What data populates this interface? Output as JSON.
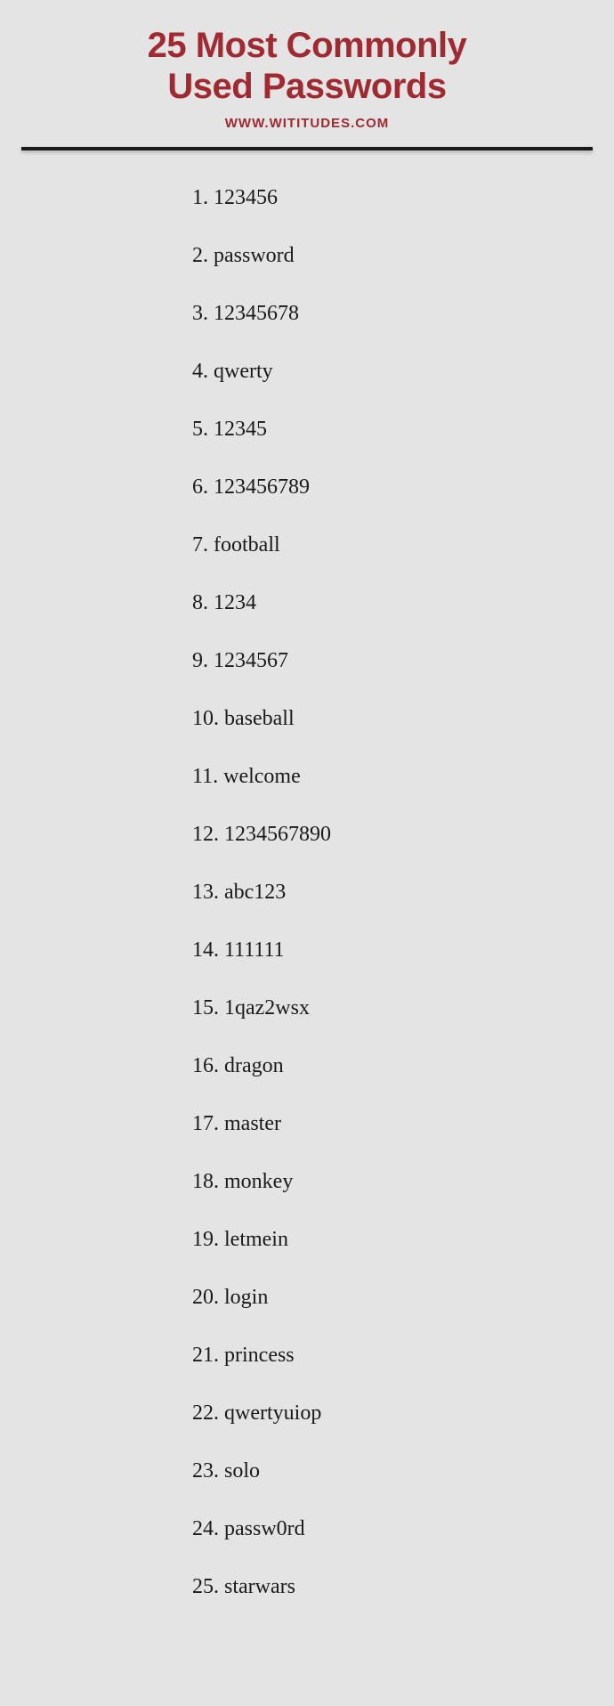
{
  "header": {
    "title_line1": "25 Most Commonly",
    "title_line2": "Used Passwords",
    "site_url": "WWW.WITITUDES.COM"
  },
  "items": [
    {
      "n": "1.",
      "text": "123456"
    },
    {
      "n": "2.",
      "text": "password"
    },
    {
      "n": "3.",
      "text": "12345678"
    },
    {
      "n": "4.",
      "text": "qwerty"
    },
    {
      "n": "5.",
      "text": "12345"
    },
    {
      "n": "6.",
      "text": "123456789"
    },
    {
      "n": "7.",
      "text": "football"
    },
    {
      "n": "8.",
      "text": "1234"
    },
    {
      "n": "9.",
      "text": "1234567"
    },
    {
      "n": "10.",
      "text": "baseball"
    },
    {
      "n": "11.",
      "text": "welcome"
    },
    {
      "n": "12.",
      "text": "1234567890"
    },
    {
      "n": "13.",
      "text": "abc123"
    },
    {
      "n": "14.",
      "text": "111111"
    },
    {
      "n": "15.",
      "text": "1qaz2wsx"
    },
    {
      "n": "16.",
      "text": "dragon"
    },
    {
      "n": "17.",
      "text": "master"
    },
    {
      "n": "18.",
      "text": "monkey"
    },
    {
      "n": "19.",
      "text": "letmein"
    },
    {
      "n": "20.",
      "text": "login"
    },
    {
      "n": "21.",
      "text": "princess"
    },
    {
      "n": "22.",
      "text": "qwertyuiop"
    },
    {
      "n": "23.",
      "text": "solo"
    },
    {
      "n": "24.",
      "text": "passw0rd"
    },
    {
      "n": "25.",
      "text": "starwars"
    }
  ]
}
